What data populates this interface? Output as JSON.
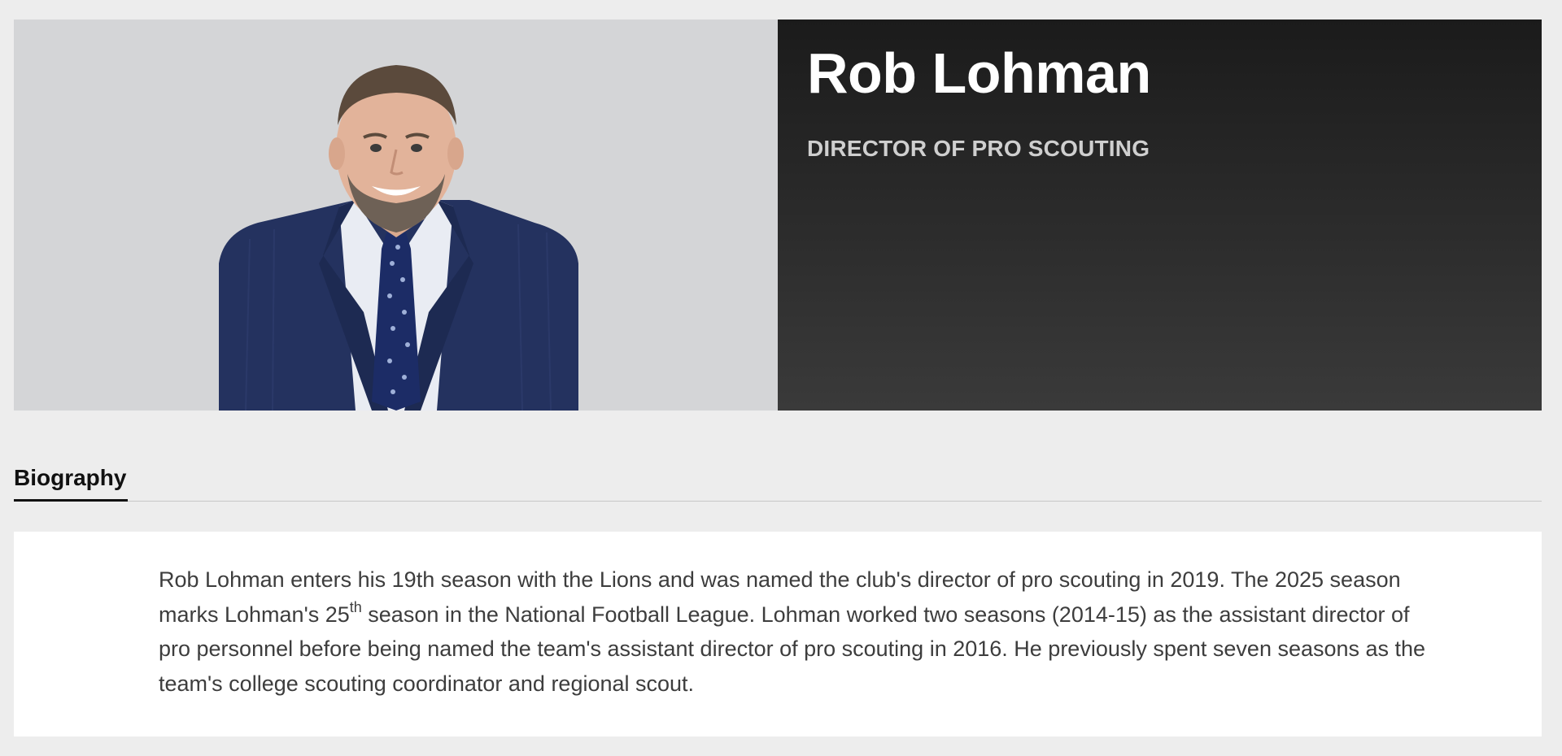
{
  "profile": {
    "name": "Rob Lohman",
    "title": "DIRECTOR OF PRO SCOUTING",
    "photo_alt": "Rob Lohman"
  },
  "tabs": {
    "biography_label": "Biography"
  },
  "biography": {
    "text_before": "Rob Lohman enters his 19th season with the Lions and was named the club's director of pro scouting in 2019. The 2025 season marks Lohman's 25",
    "superscript": "th",
    "text_after": " season in the National Football League. Lohman worked two seasons (2014-15) as the assistant director of pro personnel before being named the team's assistant director of pro scouting in 2016. He previously spent seven seasons as the team's college scouting coordinator and regional scout."
  },
  "colors": {
    "page_background": "#ededed",
    "photo_background": "#d4d5d7",
    "hero_dark": "#1b1b1b",
    "name_text": "#ffffff",
    "title_text": "#cfcfcf",
    "body_text": "#3d3d3d",
    "suit": "#24325f"
  }
}
